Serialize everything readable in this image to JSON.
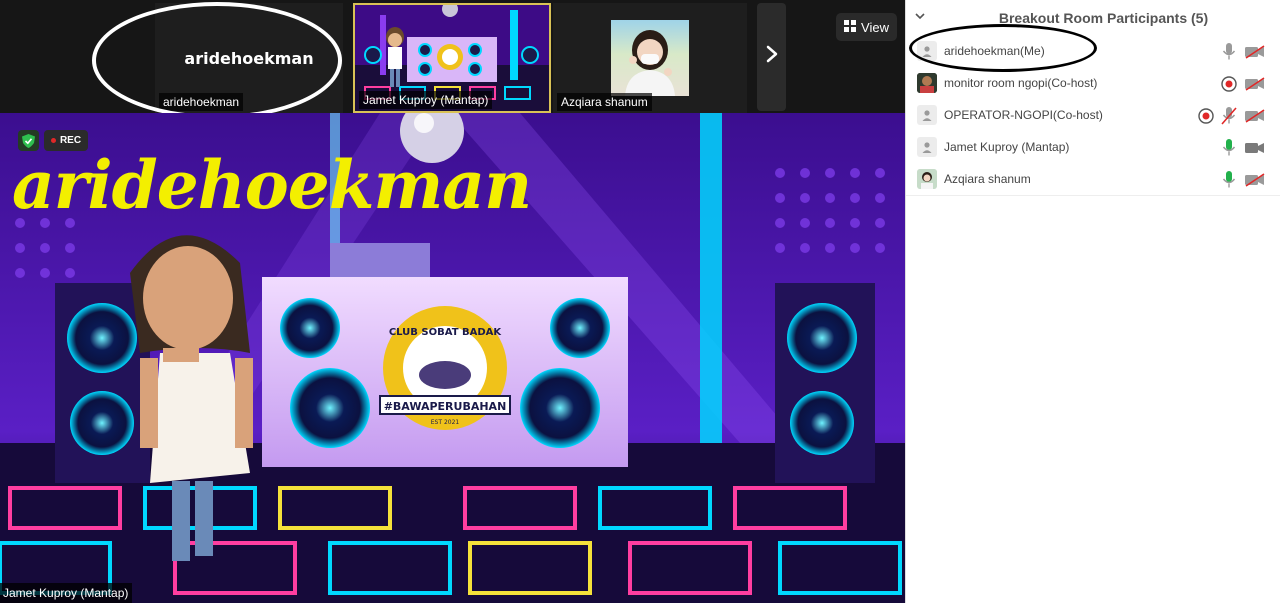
{
  "strip": {
    "tiles": [
      {
        "big_label": "aridehoekman",
        "name": "aridehoekman"
      },
      {
        "name": "Jamet Kuproy (Mantap)"
      },
      {
        "name": "Azqiara shanum"
      }
    ],
    "next_icon": "chevron-right-icon",
    "view_label": "View",
    "view_icon": "grid-icon"
  },
  "main": {
    "overlay_name": "aridehoekman",
    "rec_label": "REC",
    "speaker_name": "Jamet Kuproy (Mantap)",
    "booth_text": {
      "top": "CLUB SOBAT BADAK",
      "ribbon": "#BAWAPERUBAHAN",
      "bottom": "EST 2021"
    },
    "overlay_color": "#f3ef00",
    "accent_colors": {
      "cyan": "#00d8ff",
      "purple": "#6b2bd8",
      "yellow": "#d9c256"
    }
  },
  "panel": {
    "title": "Breakout Room Participants (5)",
    "participants": [
      {
        "name": "aridehoekman(Me)",
        "avatar": "person-icon",
        "recording": false,
        "mic": "on-grey",
        "video": "off"
      },
      {
        "name": "monitor room ngopi(Co-host)",
        "avatar": "photo-avatar",
        "recording": true,
        "mic": "none",
        "video": "off"
      },
      {
        "name": "OPERATOR-NGOPI(Co-host)",
        "avatar": "person-icon",
        "recording": true,
        "mic": "muted",
        "video": "off"
      },
      {
        "name": "Jamet Kuproy (Mantap)",
        "avatar": "person-icon",
        "recording": false,
        "mic": "on-green",
        "video": "on"
      },
      {
        "name": "Azqiara shanum",
        "avatar": "photo-avatar",
        "recording": false,
        "mic": "on-green",
        "video": "off"
      }
    ],
    "status_colors": {
      "mic_on": "#22b14c",
      "muted": "#e02828",
      "icon_grey": "#9a9a9a"
    }
  }
}
